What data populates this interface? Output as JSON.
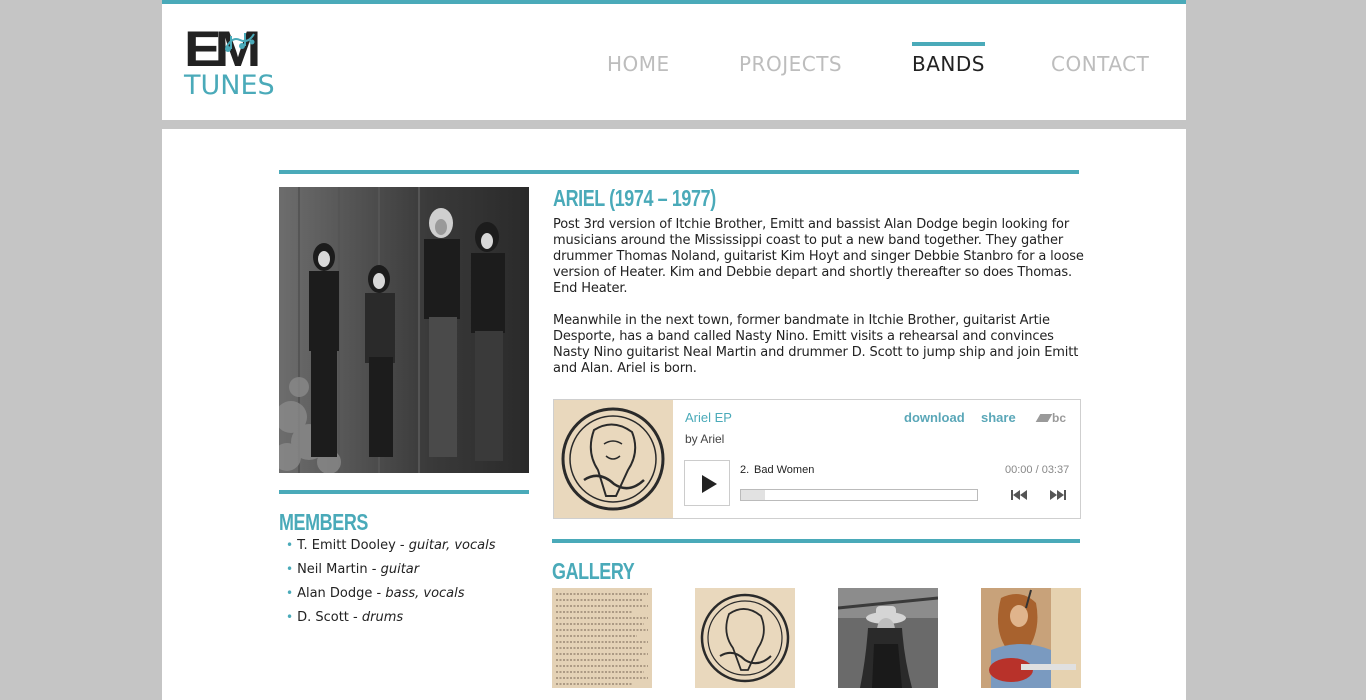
{
  "colors": {
    "accent": "#4aaab9",
    "text": "#222222",
    "nav_inactive": "#bdbdbd",
    "page_bg": "#c5c5c5"
  },
  "logo": {
    "line1": "EM",
    "line2": "TUNES",
    "icon": "music-notes-icon"
  },
  "nav": [
    {
      "label": "HOME",
      "active": false
    },
    {
      "label": "PROJECTS",
      "active": false
    },
    {
      "label": "BANDS",
      "active": true
    },
    {
      "label": "CONTACT",
      "active": false
    }
  ],
  "band": {
    "title": "ARIEL (1974 – 1977)",
    "bio": [
      "Post 3rd version of Itchie Brother, Emitt and bassist Alan Dodge begin looking for musicians around the Mississippi coast to put a new band together. They gather drummer Thomas Noland, guitarist Kim Hoyt and singer Debbie Stanbro for a loose version of Heater. Kim and Debbie depart and shortly thereafter so does Thomas. End Heater.",
      "Meanwhile in the next town, former bandmate in Itchie Brother, guitarist Artie Desporte, has a band called Nasty Nino. Emitt visits a rehearsal and convinces Nasty Nino guitarist Neal Martin and drummer D. Scott to jump ship and join Emitt and Alan. Ariel is born."
    ]
  },
  "members": {
    "heading": "MEMBERS",
    "list": [
      {
        "name": "T. Emitt Dooley",
        "sep": " - ",
        "role": "guitar, vocals"
      },
      {
        "name": "Neil Martin",
        "sep": " - ",
        "role": "guitar"
      },
      {
        "name": "Alan Dodge",
        "sep": " - ",
        "role": "bass, vocals"
      },
      {
        "name": "D. Scott",
        "sep": " - ",
        "role": "drums"
      }
    ]
  },
  "player": {
    "album": "Ariel EP",
    "artist": "by Ariel",
    "download": "download",
    "share": "share",
    "brand": "bc",
    "track_number": "2.",
    "track_name": "Bad Women",
    "time": "00:00 / 03:37",
    "progress": 0
  },
  "gallery": {
    "heading": "GALLERY",
    "thumb_count": 4
  }
}
